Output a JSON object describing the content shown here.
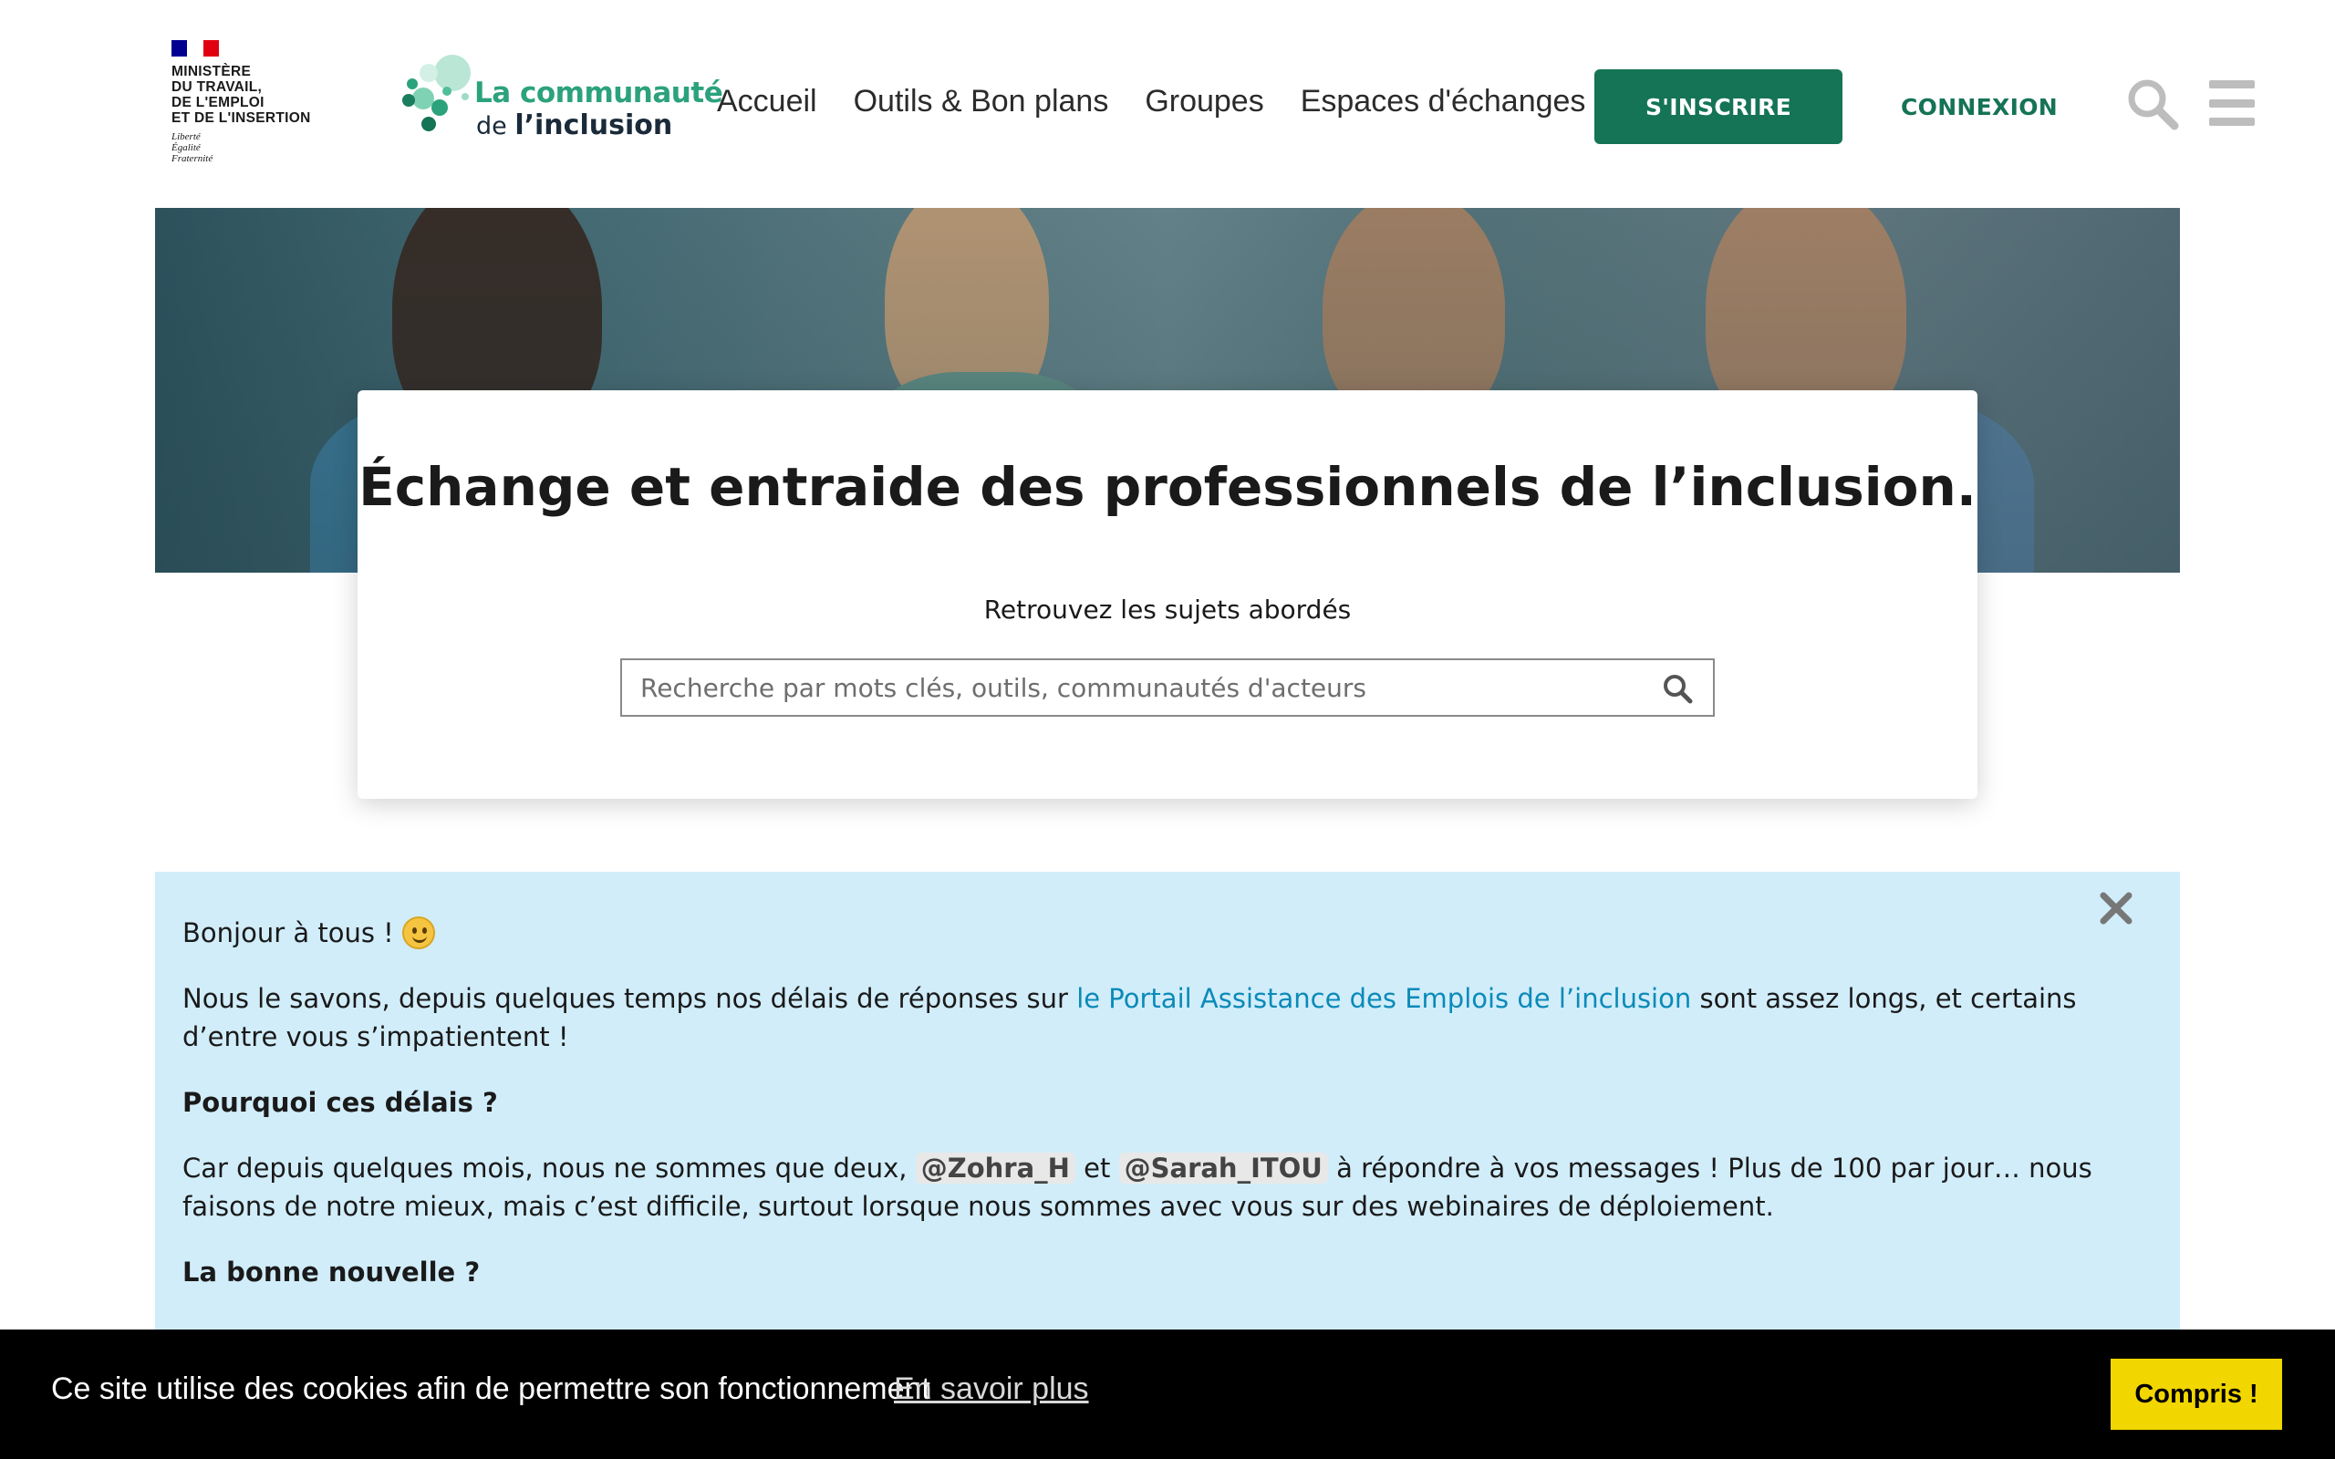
{
  "header": {
    "gov_logo": {
      "lines": [
        "MINISTÈRE",
        "DU TRAVAIL,",
        "DE L'EMPLOI",
        "ET DE L'INSERTION"
      ],
      "motto": [
        "Liberté",
        "Égalité",
        "Fraternité"
      ]
    },
    "brand": {
      "line1": "La communauté",
      "line2_prefix": "de",
      "line2_bold": "l’inclusion"
    },
    "nav": [
      "Accueil",
      "Outils & Bon plans",
      "Groupes",
      "Espaces d'échanges"
    ],
    "signup_label": "S'INSCRIRE",
    "login_label": "CONNEXION",
    "icons": [
      "search-icon",
      "menu-icon"
    ]
  },
  "hero": {
    "title_regular": "Échange et entraide ",
    "title_bold": "des professionnels de l’inclusion",
    "title_end": ".",
    "subtitle": "Retrouvez les sujets abordés",
    "search_placeholder": "Recherche par mots clés, outils, communautés d'acteurs"
  },
  "announcement": {
    "greeting": "Bonjour à tous !",
    "p1_before": "Nous le savons, depuis quelques temps nos délais de réponses sur ",
    "p1_link": "le Portail Assistance des Emplois de l’inclusion",
    "p1_after": " sont assez longs, et certains d’entre vous s’impatientent !",
    "q1": "Pourquoi ces délais ?",
    "p2_before": "Car depuis quelques mois, nous ne sommes que deux, ",
    "mention1": "@Zohra_H",
    "p2_mid": " et ",
    "mention2": "@Sarah_ITOU",
    "p2_after": " à répondre à vos messages ! Plus de 100 par jour… nous faisons de notre mieux, mais c’est difficile, surtout lorsque nous sommes avec vous sur des webinaires de déploiement.",
    "q2": "La bonne nouvelle ?"
  },
  "cookie": {
    "text": "Ce site utilise des cookies afin de permettre son fonctionnement",
    "link": "En savoir plus",
    "button": "Compris !"
  },
  "colors": {
    "primary_green": "#157356",
    "brand_green": "#2ca27c",
    "link_blue": "#0b8ab8",
    "announce_bg": "#d1edfa",
    "cookie_button": "#f1d600"
  }
}
